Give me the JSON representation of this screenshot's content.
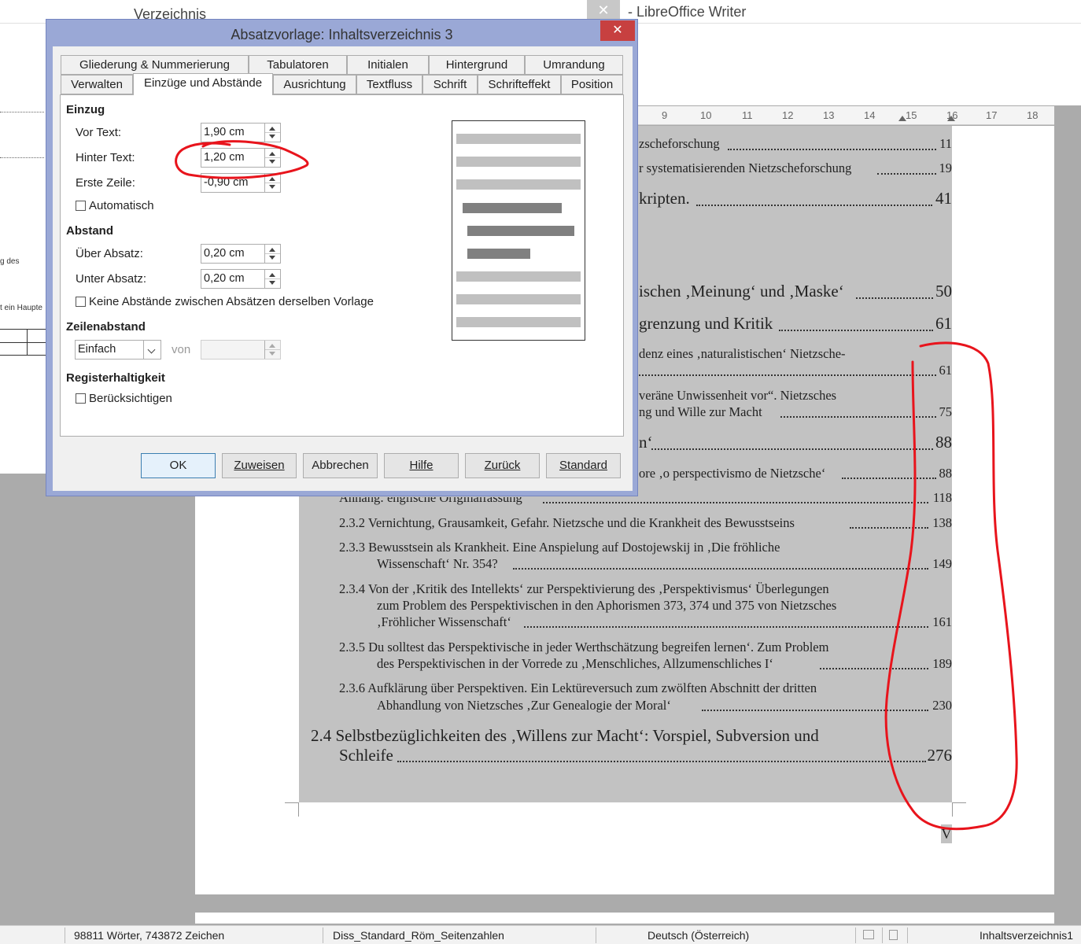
{
  "writer": {
    "title": "- LibreOffice Writer",
    "close_glyph": "✕"
  },
  "left_document": {
    "title": "Verzeichnis einfügen",
    "fragment_1": "g des",
    "fragment_2": "t ein Haupte"
  },
  "ruler": {
    "ticks": [
      "9",
      "10",
      "11",
      "12",
      "13",
      "14",
      "15",
      "16",
      "17",
      "18"
    ]
  },
  "toc": {
    "entries": [
      {
        "text": "zscheforschung",
        "page": "11",
        "size": "s"
      },
      {
        "text": "r systematisierenden Nietzscheforschung",
        "page": "19",
        "size": "s"
      },
      {
        "text": "kripten.",
        "page": "41",
        "size": "l"
      },
      {
        "text": "ischen ‚Meinung‘ und ‚Maske‘",
        "page": "50",
        "size": "l"
      },
      {
        "text": "grenzung und Kritik",
        "page": "61",
        "size": "l"
      },
      {
        "text": "denz eines ‚naturalistischen‘ Nietzsche-",
        "page": "",
        "size": "s"
      },
      {
        "text": "",
        "page": "61",
        "size": "s"
      },
      {
        "text": "veräne Unwissenheit vor“. Nietzsches",
        "page": "",
        "size": "s"
      },
      {
        "text": "ng und Wille zur Macht",
        "page": "75",
        "size": "s"
      },
      {
        "text": "n‘",
        "page": "88",
        "size": "l"
      },
      {
        "text": "ore ‚o perspectivismo de Nietzsche‘",
        "page": "88",
        "size": "s"
      },
      {
        "text": "Anhang: englische Originalfassung",
        "page": "118",
        "size": "s"
      },
      {
        "text": "2.3.2 Vernichtung, Grausamkeit, Gefahr. Nietzsche und die Krankheit des Bewusstseins",
        "page": "138",
        "size": "s"
      },
      {
        "text": "2.3.3 Bewusstsein als Krankheit. Eine Anspielung auf Dostojewskij in ‚Die fröhliche",
        "page": "",
        "size": "s"
      },
      {
        "text": "Wissenschaft‘ Nr. 354?",
        "page": "149",
        "size": "s"
      },
      {
        "text": "2.3.4 Von der ‚Kritik des Intellekts‘ zur Perspektivierung des ‚Perspektivismus‘ Überlegungen",
        "page": "",
        "size": "s"
      },
      {
        "text": "zum Problem des Perspektivischen in den Aphorismen 373, 374 und 375 von Nietzsches",
        "page": "",
        "size": "s"
      },
      {
        "text": "‚Fröhlicher Wissenschaft‘",
        "page": "161",
        "size": "s"
      },
      {
        "text": "2.3.5 Du solltest das Perspektivische in jeder Werthschätzung begreifen lernen‘. Zum Problem",
        "page": "",
        "size": "s"
      },
      {
        "text": "des Perspektivischen in der Vorrede zu ‚Menschliches, Allzumenschliches I‘",
        "page": "189",
        "size": "s"
      },
      {
        "text": "2.3.6 Aufklärung über Perspektiven. Ein Lektüreversuch zum zwölften Abschnitt der dritten",
        "page": "",
        "size": "s"
      },
      {
        "text": "Abhandlung von Nietzsches ‚Zur Genealogie der Moral‘",
        "page": "230",
        "size": "s"
      },
      {
        "text": "2.4 Selbstbezüglichkeiten des ‚Willens zur Macht‘: Vorspiel, Subversion und",
        "page": "",
        "size": "l"
      },
      {
        "text": "Schleife",
        "page": "276",
        "size": "l"
      }
    ],
    "page_number": "V"
  },
  "statusbar": {
    "words": "98811 Wörter, 743872 Zeichen",
    "page_style": "Diss_Standard_Röm_Seitenzahlen",
    "language": "Deutsch (Österreich)",
    "paragraph_style": "Inhaltsverzeichnis1"
  },
  "dialog": {
    "title": "Absatzvorlage: Inhaltsverzeichnis 3",
    "close_glyph": "✕",
    "tabs_row1": [
      "Gliederung & Nummerierung",
      "Tabulatoren",
      "Initialen",
      "Hintergrund",
      "Umrandung"
    ],
    "tabs_row2": [
      "Verwalten",
      "Einzüge und Abstände",
      "Ausrichtung",
      "Textfluss",
      "Schrift",
      "Schrifteffekt",
      "Position"
    ],
    "active_tab": "Einzüge und Abstände",
    "einzug": {
      "heading": "Einzug",
      "vor_text_label": "Vor Text:",
      "vor_text_value": "1,90 cm",
      "hinter_text_label": "Hinter Text:",
      "hinter_text_value": "1,20 cm",
      "erste_zeile_label": "Erste Zeile:",
      "erste_zeile_value": "-0,90 cm",
      "automatisch_label": "Automatisch",
      "automatisch_checked": false
    },
    "abstand": {
      "heading": "Abstand",
      "ueber_label": "Über Absatz:",
      "ueber_value": "0,20 cm",
      "unter_label": "Unter Absatz:",
      "unter_value": "0,20 cm",
      "keine_label": "Keine Abstände zwischen Absätzen derselben Vorlage",
      "keine_checked": false
    },
    "zeilenabstand": {
      "heading": "Zeilenabstand",
      "select_value": "Einfach",
      "von_label": "von",
      "von_value": ""
    },
    "register": {
      "heading": "Registerhaltigkeit",
      "label": "Berücksichtigen",
      "checked": false
    },
    "buttons": {
      "ok": "OK",
      "zuweisen": "Zuweisen",
      "abbrechen": "Abbrechen",
      "hilfe": "Hilfe",
      "zurueck": "Zurück",
      "standard": "Standard"
    }
  },
  "colors": {
    "dialog_frame": "#9aa8d6",
    "close_red": "#c74040",
    "annotation_red": "#e8141c",
    "toc_highlight": "#c2c2c2"
  }
}
